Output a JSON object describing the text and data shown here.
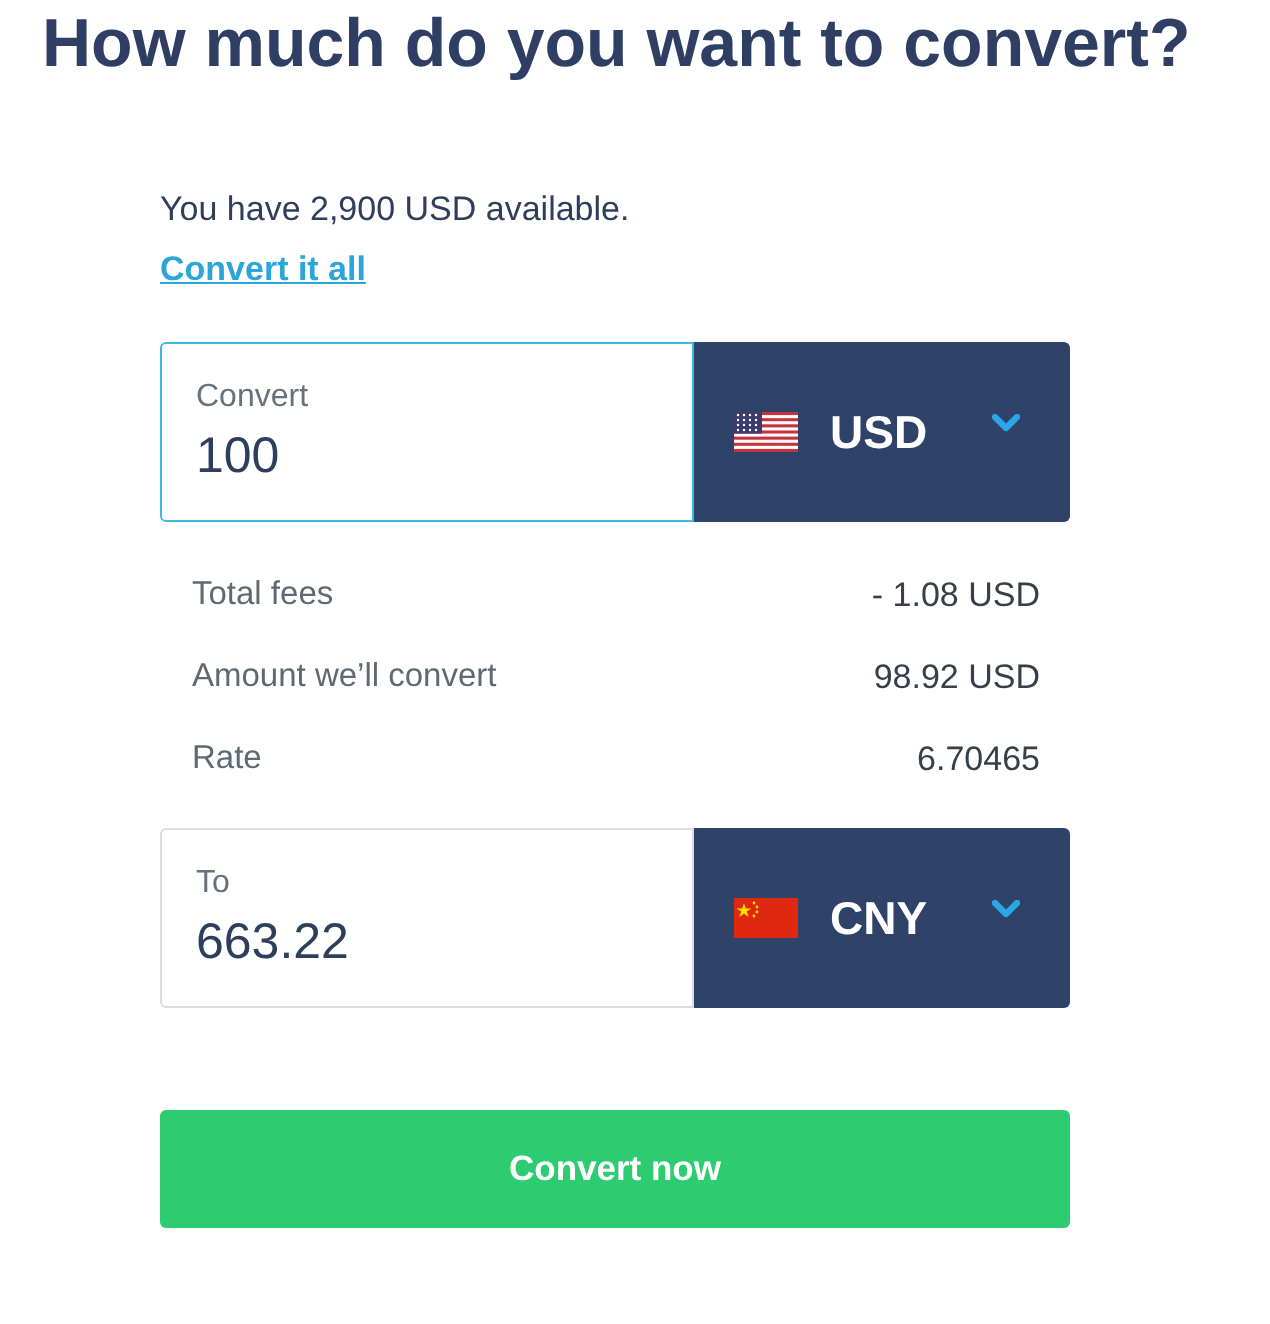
{
  "title": "How much do you want to convert?",
  "balance_text": "You have 2,900 USD available.",
  "convert_all_link": "Convert it all",
  "amounts": [
    {
      "label": "Convert",
      "value": "100",
      "focused": true,
      "currency": "USD"
    },
    {
      "label": "To",
      "value": "663.22",
      "focused": false,
      "currency": "CNY"
    }
  ],
  "details": [
    {
      "label": "Total fees",
      "value": "- 1.08 USD"
    },
    {
      "label": "Amount we’ll convert",
      "value": "98.92 USD"
    },
    {
      "label": "Rate",
      "value": "6.70465"
    }
  ],
  "button": "Convert now"
}
